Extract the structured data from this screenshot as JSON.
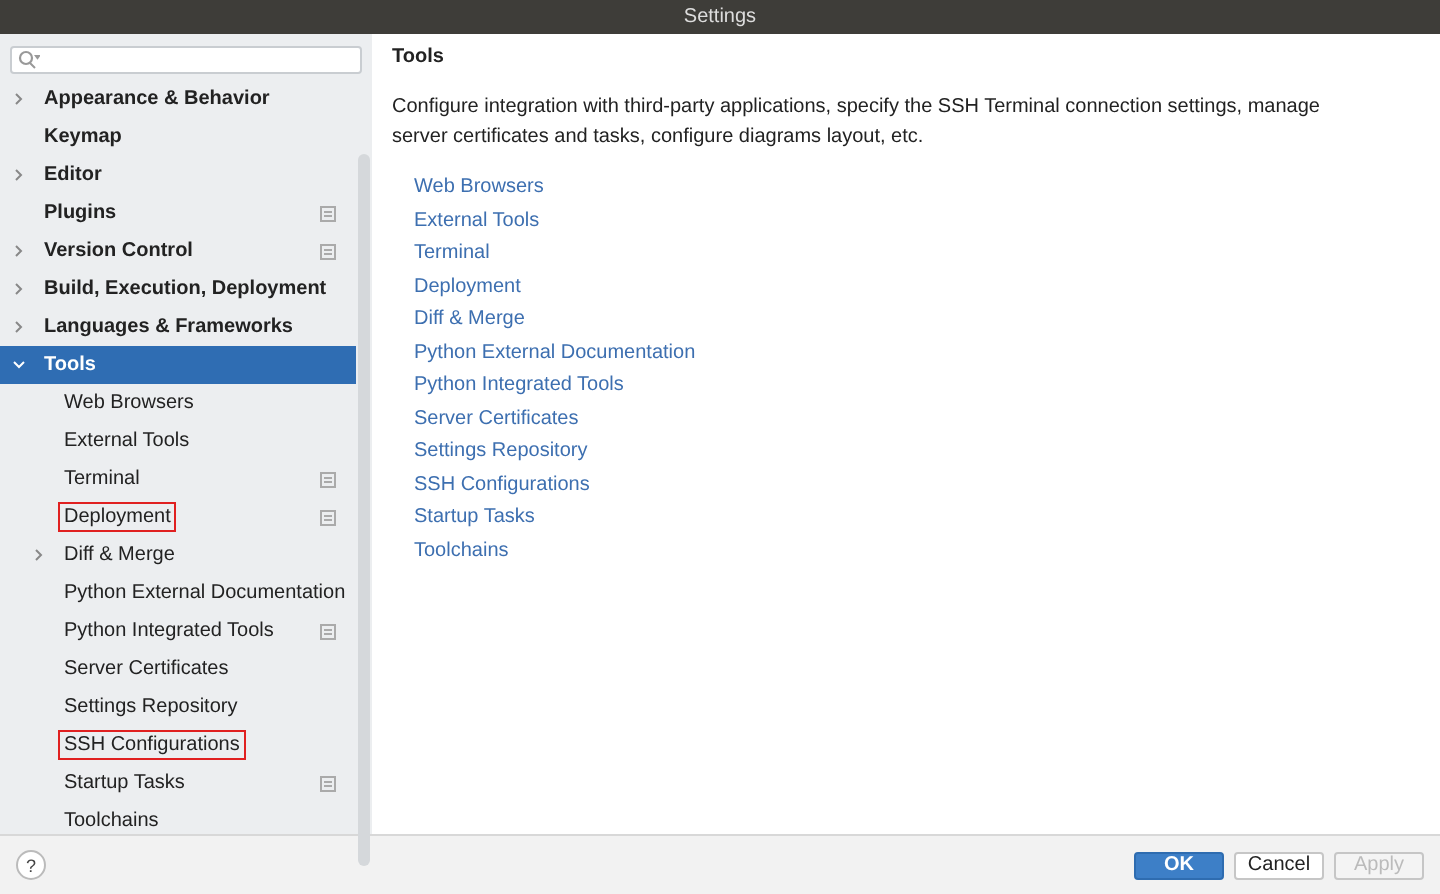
{
  "window": {
    "title": "Settings"
  },
  "tree": [
    {
      "label": "Appearance & Behavior",
      "expanded": false,
      "has_children": true,
      "project_icon": false,
      "selected": false,
      "highlighted": false
    },
    {
      "label": "Keymap",
      "has_children": false,
      "project_icon": false,
      "selected": false,
      "highlighted": false
    },
    {
      "label": "Editor",
      "expanded": false,
      "has_children": true,
      "project_icon": false,
      "selected": false,
      "highlighted": false
    },
    {
      "label": "Plugins",
      "has_children": false,
      "project_icon": true,
      "selected": false,
      "highlighted": false
    },
    {
      "label": "Version Control",
      "expanded": false,
      "has_children": true,
      "project_icon": true,
      "selected": false,
      "highlighted": false
    },
    {
      "label": "Build, Execution, Deployment",
      "expanded": false,
      "has_children": true,
      "project_icon": false,
      "selected": false,
      "highlighted": false
    },
    {
      "label": "Languages & Frameworks",
      "expanded": false,
      "has_children": true,
      "project_icon": false,
      "selected": false,
      "highlighted": false
    },
    {
      "label": "Tools",
      "expanded": true,
      "has_children": true,
      "project_icon": false,
      "selected": true,
      "highlighted": false,
      "children": [
        {
          "label": "Web Browsers",
          "has_children": false,
          "project_icon": false,
          "selected": false,
          "highlighted": false
        },
        {
          "label": "External Tools",
          "has_children": false,
          "project_icon": false,
          "selected": false,
          "highlighted": false
        },
        {
          "label": "Terminal",
          "has_children": false,
          "project_icon": true,
          "selected": false,
          "highlighted": false
        },
        {
          "label": "Deployment",
          "has_children": false,
          "project_icon": true,
          "selected": false,
          "highlighted": true
        },
        {
          "label": "Diff & Merge",
          "expanded": false,
          "has_children": true,
          "project_icon": false,
          "selected": false,
          "highlighted": false
        },
        {
          "label": "Python External Documentation",
          "has_children": false,
          "project_icon": false,
          "selected": false,
          "highlighted": false
        },
        {
          "label": "Python Integrated Tools",
          "has_children": false,
          "project_icon": true,
          "selected": false,
          "highlighted": false
        },
        {
          "label": "Server Certificates",
          "has_children": false,
          "project_icon": false,
          "selected": false,
          "highlighted": false
        },
        {
          "label": "Settings Repository",
          "has_children": false,
          "project_icon": false,
          "selected": false,
          "highlighted": false
        },
        {
          "label": "SSH Configurations",
          "has_children": false,
          "project_icon": false,
          "selected": false,
          "highlighted": true
        },
        {
          "label": "Startup Tasks",
          "has_children": false,
          "project_icon": true,
          "selected": false,
          "highlighted": false
        },
        {
          "label": "Toolchains",
          "has_children": false,
          "project_icon": false,
          "selected": false,
          "highlighted": false
        }
      ]
    }
  ],
  "content": {
    "title": "Tools",
    "description": "Configure integration with third-party applications, specify the SSH Terminal connection settings, manage server certificates and tasks, configure diagrams layout, etc.",
    "links": [
      "Web Browsers",
      "External Tools",
      "Terminal",
      "Deployment",
      "Diff & Merge",
      "Python External Documentation",
      "Python Integrated Tools",
      "Server Certificates",
      "Settings Repository",
      "SSH Configurations",
      "Startup Tasks",
      "Toolchains"
    ]
  },
  "help_button": "?",
  "buttons": [
    {
      "label": "OK",
      "kind": "primary",
      "disabled": false
    },
    {
      "label": "Cancel",
      "kind": "normal",
      "disabled": false
    },
    {
      "label": "Apply",
      "kind": "normal",
      "disabled": true
    }
  ]
}
